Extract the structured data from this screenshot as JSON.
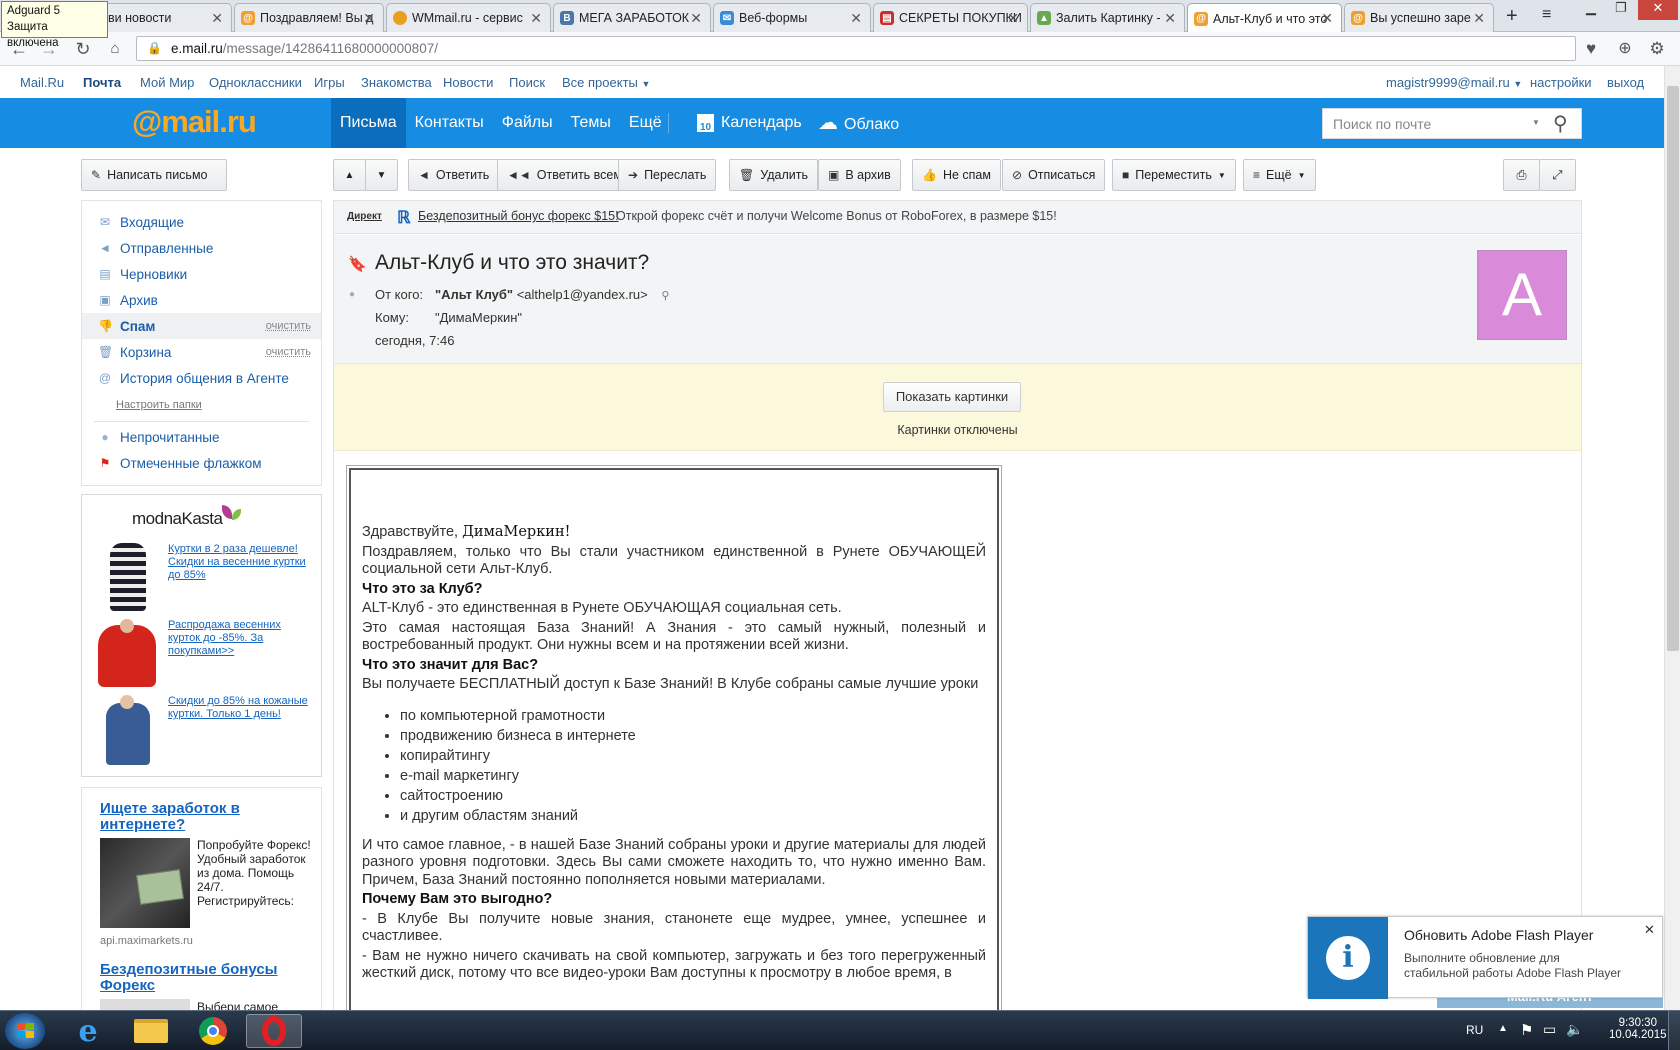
{
  "browser": {
    "adguard": {
      "line1": "Adguard 5",
      "line2": "Защита включена"
    },
    "tabs": [
      {
        "label": "ви новости",
        "icon": "mailru-icon"
      },
      {
        "label": "Поздравляем! Вы д",
        "icon": "mailru-icon"
      },
      {
        "label": "WMmail.ru - сервис",
        "icon": "wmmail-icon"
      },
      {
        "label": "МЕГА ЗАРАБОТОК",
        "icon": "vk-icon"
      },
      {
        "label": "Веб-формы",
        "icon": "mail-icon"
      },
      {
        "label": "СЕКРЕТЫ ПОКУПКИ",
        "icon": "book-icon"
      },
      {
        "label": "Залить Картинку - ",
        "icon": "image-icon"
      },
      {
        "label": "Альт-Клуб и что это",
        "icon": "mailru-icon",
        "active": true
      },
      {
        "label": "Вы успешно заре",
        "icon": "mailru-icon"
      }
    ],
    "url_host": "e.mail.ru",
    "url_path": "/message/14286411680000000807/"
  },
  "toplinks": {
    "mailru": "Mail.Ru",
    "pochta": "Почта",
    "moimir": "Мой Мир",
    "ok": "Одноклассники",
    "games": "Игры",
    "dating": "Знакомства",
    "news": "Новости",
    "search": "Поиск",
    "projects": "Все проекты",
    "user": "magistr9999@mail.ru",
    "settings": "настройки",
    "logout": "выход"
  },
  "header": {
    "logo": "@mail.ru",
    "tabs": [
      "Письма",
      "Контакты",
      "Файлы",
      "Темы",
      "Ещё"
    ],
    "calendar": "Календарь",
    "calendar_day": "10",
    "cloud": "Облако",
    "search_placeholder": "Поиск по почте"
  },
  "toolbar": {
    "compose": "Написать письмо",
    "reply": "Ответить",
    "reply_all": "Ответить всем",
    "forward": "Переслать",
    "delete": "Удалить",
    "archive": "В архив",
    "not_spam": "Не спам",
    "unsubscribe": "Отписаться",
    "move": "Переместить",
    "more": "Ещё"
  },
  "folders": [
    {
      "label": "Входящие",
      "icon": "inbox-icon"
    },
    {
      "label": "Отправленные",
      "icon": "sent-icon"
    },
    {
      "label": "Черновики",
      "icon": "drafts-icon"
    },
    {
      "label": "Архив",
      "icon": "archive-icon"
    },
    {
      "label": "Спам",
      "icon": "spam-icon",
      "action": "очистить"
    },
    {
      "label": "Корзина",
      "icon": "trash-icon",
      "action": "очистить"
    },
    {
      "label": "История общения в Агенте",
      "icon": "agent-icon"
    }
  ],
  "folders_setup": "Настроить папки",
  "filters": [
    {
      "label": "Непрочитанные",
      "icon": "unread-dot-icon"
    },
    {
      "label": "Отмеченные флажком",
      "icon": "flag-icon"
    }
  ],
  "ad_kasta": {
    "brand": "modnaKasta",
    "items": [
      "Куртки в 2 раза дешевле! Скидки на весенние куртки до 85%",
      "Распродажа весенних курток до -85%. За покупками>>",
      "Скидки до 85% на кожаные куртки. Только 1 день!"
    ]
  },
  "ad_forex": {
    "title": "Ищете заработок в интернете?",
    "text": "Попробуйте Форекс! Удобный заработок из дома. Помощь 24/7. Регистрируйтесь:",
    "domain": "api.maximarkets.ru",
    "title2": "Бездепозитные бонусы Форекс",
    "text2": "Выбери самое"
  },
  "direct": {
    "label": "Директ",
    "link": "Бездепозитный бонус форекс $15!",
    "text": "Открой форекс счёт и получи Welcome Bonus от RoboForex, в размере $15!"
  },
  "message": {
    "subject": "Альт-Клуб и что это значит?",
    "from_label": "От кого:",
    "from_name": "\"Альт Клуб\"",
    "from_email": "<althelp1@yandex.ru>",
    "to_label": "Кому:",
    "to": "\"ДимаМеркин\"",
    "date": "сегодня, 7:46",
    "avatar_letter": "A",
    "show_images": "Показать картинки",
    "images_off": "Картинки отключены"
  },
  "letter": {
    "greeting": "Здравствуйте,",
    "name": "ДимаМеркин!",
    "p1": "Поздравляем, только что Вы стали участником единственной в Рунете ОБУЧАЮЩЕЙ социальной сети Альт-Клуб.",
    "h1": "Что это за Клуб?",
    "p2": "ALT-Клуб - это единственная в Рунете ОБУЧАЮЩАЯ социальная сеть.",
    "p3": "Это самая настоящая База Знаний! А Знания - это самый нужный, полезный и востребованный продукт. Они нужны всем и на протяжении всей жизни.",
    "h2": "Что это значит для Вас?",
    "p4": "Вы получаете БЕСПЛАТНЫЙ доступ к Базе Знаний! В Клубе собраны самые лучшие уроки",
    "list": [
      "по компьютерной грамотности",
      "продвижению бизнеса в интернете",
      "копирайтингу",
      "e-mail маркетингу",
      "сайтостроению",
      "и другим областям знаний"
    ],
    "p5": "И что самое главное, - в нашей Базе Знаний собраны уроки и другие материалы для людей разного уровня подготовки. Здесь Вы сами сможете находить то, что нужно именно Вам. Причем, База Знаний постоянно пополняется новыми материалами.",
    "h3": "Почему Вам это выгодно?",
    "p6": "- В Клубе Вы получите новые знания, станонете еще мудрее, умнее, успешнее и счастливее.",
    "p7": "- Вам не нужно ничего скачивать на свой компьютер, загружать и без того перегруженный жесткий диск, потому что все видео-уроки Вам доступны к просмотру в любое время, в"
  },
  "flash": {
    "title": "Обновить Adobe Flash Player",
    "text": "Выполните обновление для стабильной работы Adobe Flash Player",
    "agent": "Mail.Ru Агент"
  },
  "taskbar": {
    "lang": "RU",
    "time": "9:30:30",
    "date": "10.04.2015"
  },
  "colors": {
    "header_blue": "#168de2",
    "active_tab_blue": "#0a6dbd",
    "logo_orange": "#f9a825",
    "link": "#1b5ea7",
    "avatar": "#d98ad9",
    "flash_blue": "#1a75bb"
  }
}
